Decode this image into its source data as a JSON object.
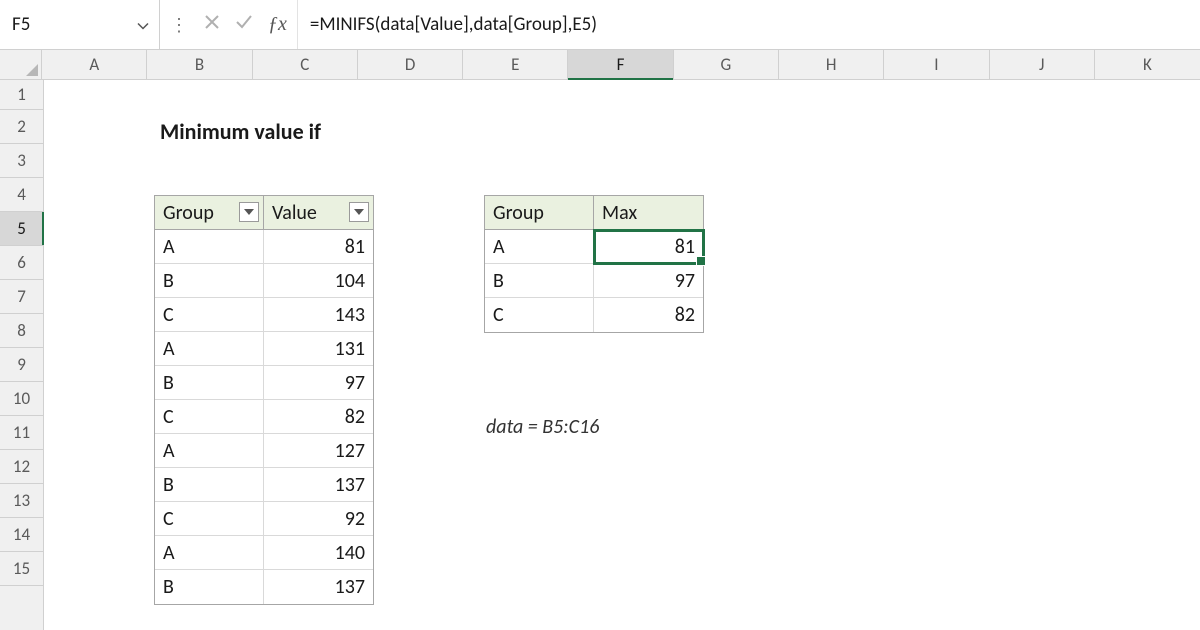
{
  "name_box": {
    "value": "F5"
  },
  "formula_bar": {
    "value": "=MINIFS(data[Value],data[Group],E5)"
  },
  "columns": [
    "A",
    "B",
    "C",
    "D",
    "E",
    "F",
    "G",
    "H",
    "I",
    "J",
    "K"
  ],
  "active_column": "F",
  "rows": [
    "1",
    "2",
    "3",
    "4",
    "5",
    "6",
    "7",
    "8",
    "9",
    "10",
    "11",
    "12",
    "13",
    "14",
    "15"
  ],
  "active_row": "5",
  "sheet": {
    "title": "Minimum value if",
    "note": "data = B5:C16",
    "data_table": {
      "headers": {
        "group": "Group",
        "value": "Value"
      },
      "rows": [
        {
          "group": "A",
          "value": 81
        },
        {
          "group": "B",
          "value": 104
        },
        {
          "group": "C",
          "value": 143
        },
        {
          "group": "A",
          "value": 131
        },
        {
          "group": "B",
          "value": 97
        },
        {
          "group": "C",
          "value": 82
        },
        {
          "group": "A",
          "value": 127
        },
        {
          "group": "B",
          "value": 137
        },
        {
          "group": "C",
          "value": 92
        },
        {
          "group": "A",
          "value": 140
        },
        {
          "group": "B",
          "value": 137
        }
      ]
    },
    "summary_table": {
      "headers": {
        "group": "Group",
        "max": "Max"
      },
      "rows": [
        {
          "group": "A",
          "max": 81
        },
        {
          "group": "B",
          "max": 97
        },
        {
          "group": "C",
          "max": 82
        }
      ]
    }
  },
  "chart_data": {
    "type": "table",
    "title": "Minimum value if",
    "source_range": "B5:C16",
    "columns": [
      "Group",
      "Value"
    ],
    "rows": [
      [
        "A",
        81
      ],
      [
        "B",
        104
      ],
      [
        "C",
        143
      ],
      [
        "A",
        131
      ],
      [
        "B",
        97
      ],
      [
        "C",
        82
      ],
      [
        "A",
        127
      ],
      [
        "B",
        137
      ],
      [
        "C",
        92
      ],
      [
        "A",
        140
      ],
      [
        "B",
        137
      ]
    ],
    "summary": {
      "columns": [
        "Group",
        "Max"
      ],
      "rows": [
        [
          "A",
          81
        ],
        [
          "B",
          97
        ],
        [
          "C",
          82
        ]
      ]
    }
  }
}
